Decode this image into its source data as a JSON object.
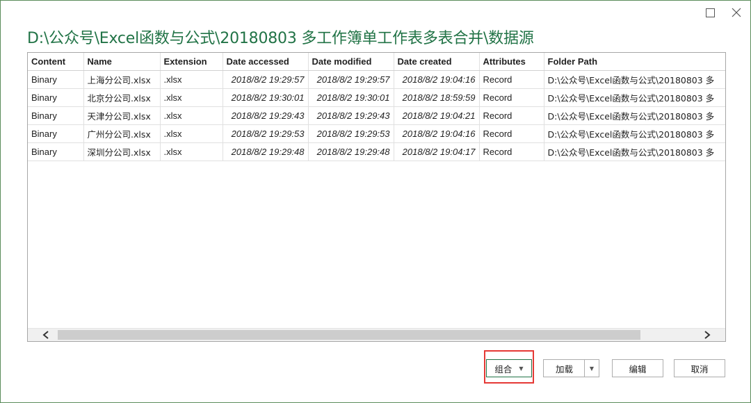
{
  "window": {
    "title": "D:\\公众号\\Excel函数与公式\\20180803 多工作簿单工作表多表合并\\数据源"
  },
  "table": {
    "columns": [
      "Content",
      "Name",
      "Extension",
      "Date accessed",
      "Date modified",
      "Date created",
      "Attributes",
      "Folder Path"
    ],
    "rows": [
      {
        "content": "Binary",
        "name": "上海分公司.xlsx",
        "extension": ".xlsx",
        "accessed": "2018/8/2 19:29:57",
        "modified": "2018/8/2 19:29:57",
        "created": "2018/8/2 19:04:16",
        "attributes": "Record",
        "folder": "D:\\公众号\\Excel函数与公式\\20180803 多"
      },
      {
        "content": "Binary",
        "name": "北京分公司.xlsx",
        "extension": ".xlsx",
        "accessed": "2018/8/2 19:30:01",
        "modified": "2018/8/2 19:30:01",
        "created": "2018/8/2 18:59:59",
        "attributes": "Record",
        "folder": "D:\\公众号\\Excel函数与公式\\20180803 多"
      },
      {
        "content": "Binary",
        "name": "天津分公司.xlsx",
        "extension": ".xlsx",
        "accessed": "2018/8/2 19:29:43",
        "modified": "2018/8/2 19:29:43",
        "created": "2018/8/2 19:04:21",
        "attributes": "Record",
        "folder": "D:\\公众号\\Excel函数与公式\\20180803 多"
      },
      {
        "content": "Binary",
        "name": "广州分公司.xlsx",
        "extension": ".xlsx",
        "accessed": "2018/8/2 19:29:53",
        "modified": "2018/8/2 19:29:53",
        "created": "2018/8/2 19:04:16",
        "attributes": "Record",
        "folder": "D:\\公众号\\Excel函数与公式\\20180803 多"
      },
      {
        "content": "Binary",
        "name": "深圳分公司.xlsx",
        "extension": ".xlsx",
        "accessed": "2018/8/2 19:29:48",
        "modified": "2018/8/2 19:29:48",
        "created": "2018/8/2 19:04:17",
        "attributes": "Record",
        "folder": "D:\\公众号\\Excel函数与公式\\20180803 多"
      }
    ]
  },
  "buttons": {
    "combine": "组合",
    "load": "加载",
    "edit": "编辑",
    "cancel": "取消"
  },
  "icons": {
    "maximize": "maximize-icon",
    "close": "close-icon",
    "scroll_left": "chevron-left-icon",
    "scroll_right": "chevron-right-icon",
    "dropdown": "caret-down-icon"
  },
  "colors": {
    "title": "#217346",
    "highlight": "#e53935",
    "window_border": "#5b8c5a"
  }
}
